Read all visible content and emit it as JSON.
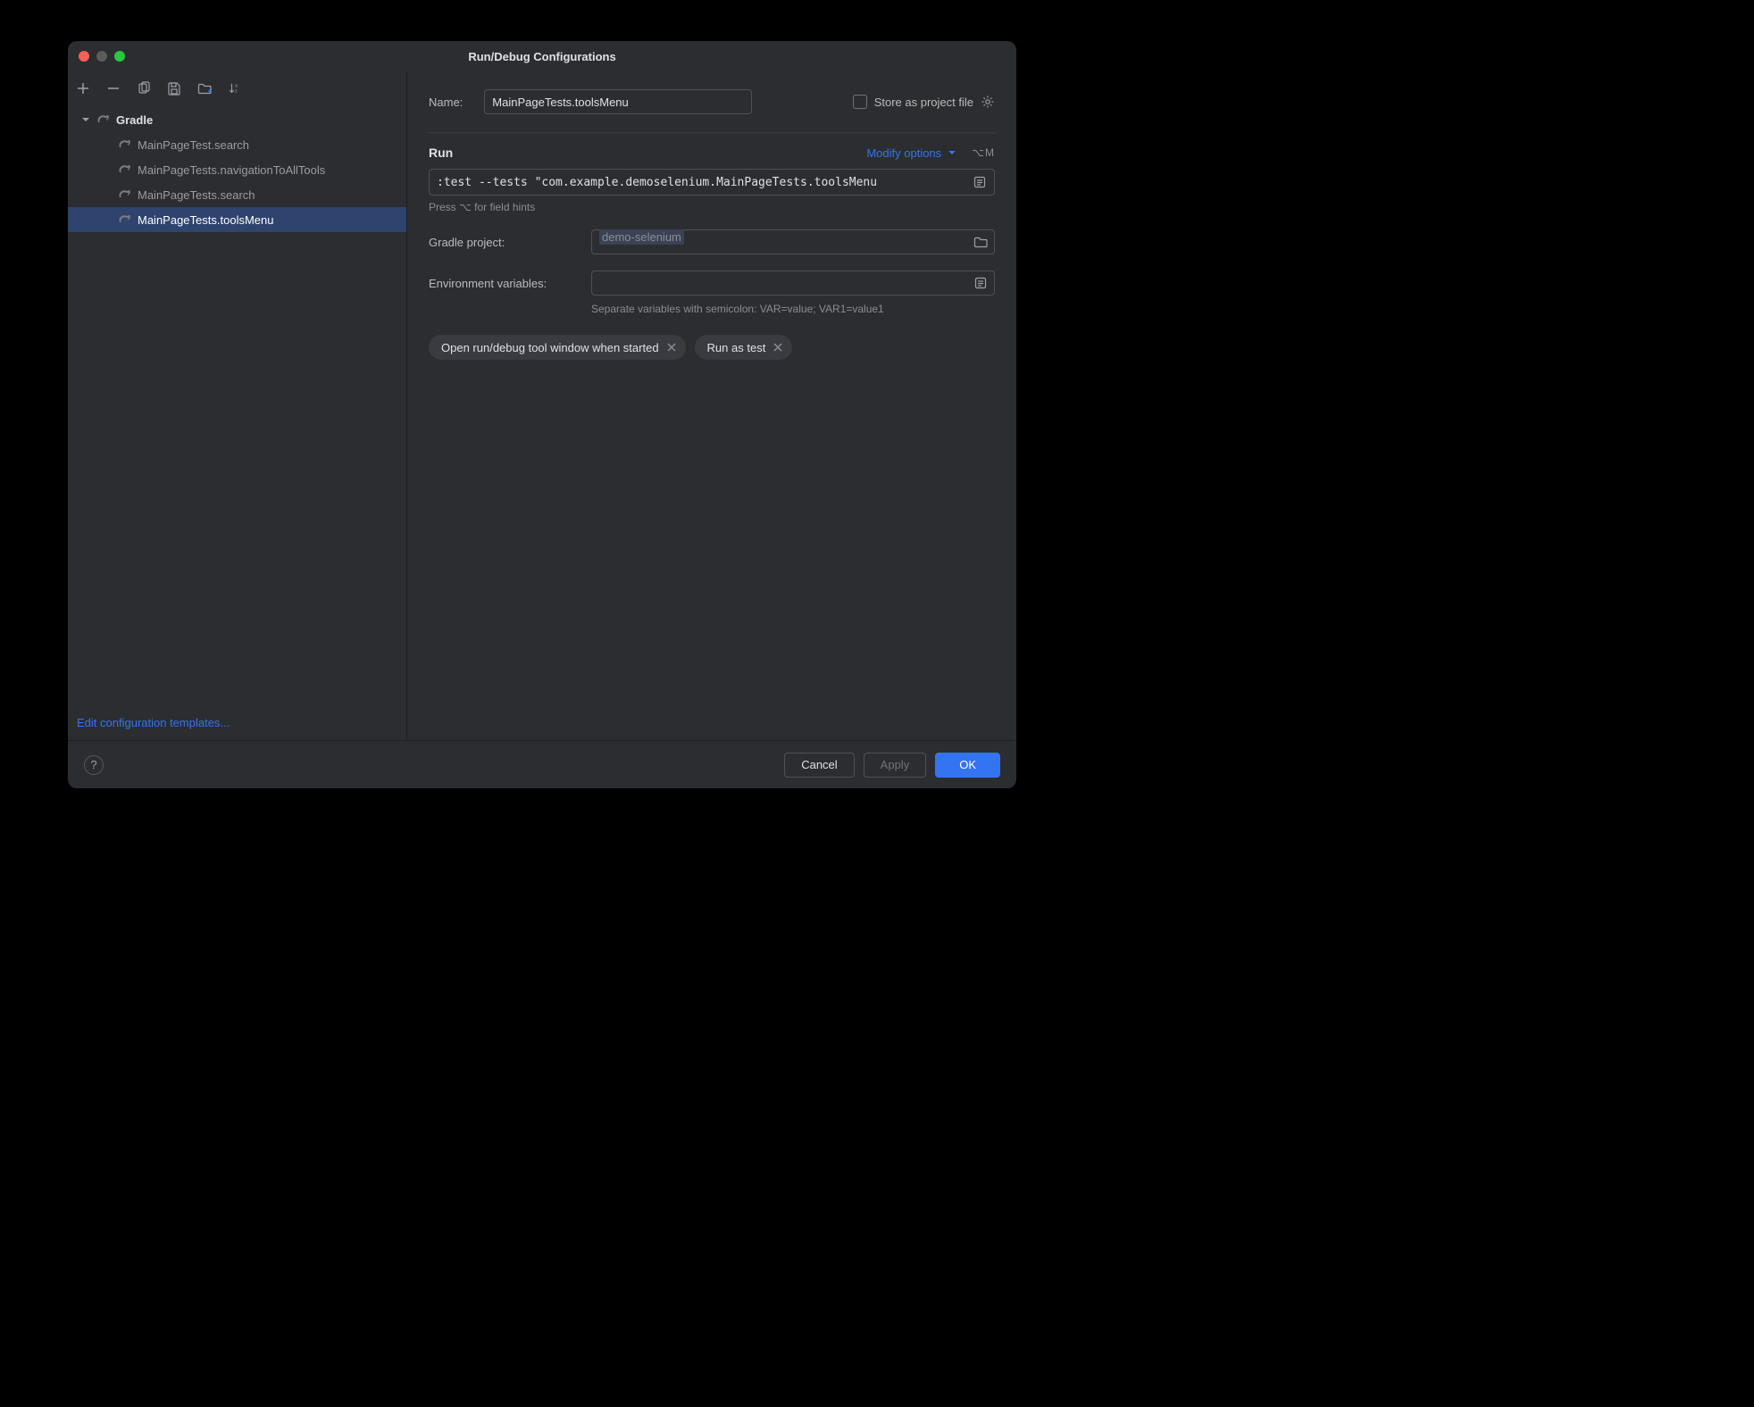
{
  "window": {
    "title": "Run/Debug Configurations"
  },
  "tree": {
    "category": "Gradle",
    "items": [
      {
        "label": "MainPageTest.search"
      },
      {
        "label": "MainPageTests.navigationToAllTools"
      },
      {
        "label": "MainPageTests.search"
      },
      {
        "label": "MainPageTests.toolsMenu",
        "selected": true
      }
    ]
  },
  "left_footer_link": "Edit configuration templates...",
  "form": {
    "name_label": "Name:",
    "name_value": "MainPageTests.toolsMenu",
    "store_label": "Store as project file",
    "run_title": "Run",
    "modify_label": "Modify options",
    "modify_shortcut": "⌥M",
    "command_value": ":test --tests \"com.example.demoselenium.MainPageTests.toolsMenu",
    "command_hint": "Press ⌥ for field hints",
    "gradle_label": "Gradle project:",
    "gradle_value": "demo-selenium",
    "env_label": "Environment variables:",
    "env_hint": "Separate variables with semicolon: VAR=value; VAR1=value1",
    "chips": [
      "Open run/debug tool window when started",
      "Run as test"
    ]
  },
  "footer": {
    "cancel": "Cancel",
    "apply": "Apply",
    "ok": "OK"
  }
}
